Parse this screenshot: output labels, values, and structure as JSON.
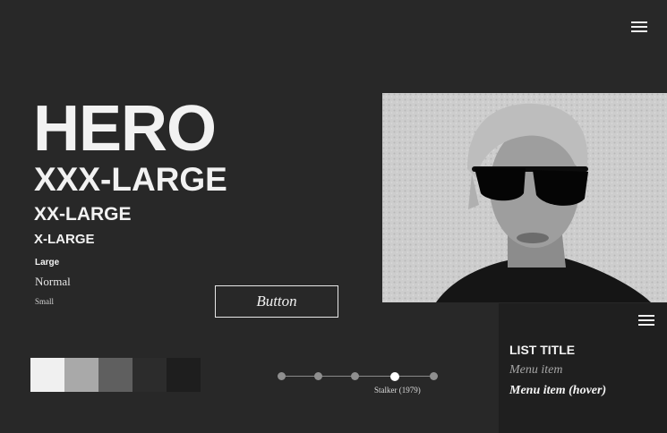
{
  "typography": {
    "hero": "HERO",
    "xxx_large": "XXX-LARGE",
    "xx_large": "XX-LARGE",
    "x_large": "X-LARGE",
    "large": "Large",
    "normal": "Normal",
    "small": "Small"
  },
  "button": {
    "label": "Button"
  },
  "swatches": [
    "#f0f0f0",
    "#a9a9a9",
    "#5f5f5f",
    "#2c2c2c",
    "#1e1e1e"
  ],
  "slider": {
    "caption": "Stalker (1979)",
    "dot_count": 5,
    "active_index": 3
  },
  "menu_panel": {
    "title": "LIST TITLE",
    "items": [
      "Menu item",
      "Menu item (hover)"
    ]
  },
  "icons": {
    "top_menu": "hamburger-menu-icon",
    "panel_menu": "hamburger-menu-icon"
  }
}
